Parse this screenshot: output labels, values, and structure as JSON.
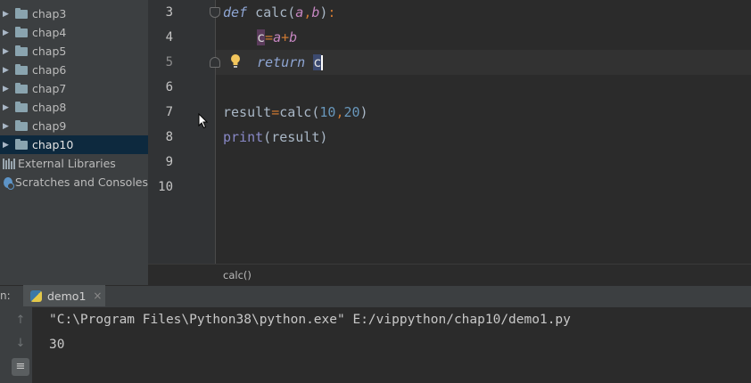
{
  "project_tree": {
    "items": [
      {
        "label": "chap3",
        "icon": "folder-icon",
        "collapsed": true
      },
      {
        "label": "chap4",
        "icon": "folder-icon",
        "collapsed": true
      },
      {
        "label": "chap5",
        "icon": "folder-icon",
        "collapsed": true
      },
      {
        "label": "chap6",
        "icon": "folder-icon",
        "collapsed": true
      },
      {
        "label": "chap7",
        "icon": "folder-icon",
        "collapsed": true
      },
      {
        "label": "chap8",
        "icon": "folder-icon",
        "collapsed": true
      },
      {
        "label": "chap9",
        "icon": "folder-icon",
        "collapsed": true
      },
      {
        "label": "chap10",
        "icon": "folder-icon",
        "collapsed": true,
        "selected": true
      },
      {
        "label": "External Libraries",
        "icon": "library-icon"
      },
      {
        "label": "Scratches and Consoles",
        "icon": "scratch-icon"
      }
    ]
  },
  "editor": {
    "line_numbers": [
      "3",
      "4",
      "5",
      "6",
      "7",
      "8",
      "9",
      "10"
    ],
    "current_line": "5",
    "lines": {
      "l3": {
        "kw": "def",
        "name": " calc",
        "open": "(",
        "p1": "a",
        "comma": ",",
        "p2": "b",
        "close": ")",
        "colon": ":"
      },
      "l4": {
        "var": "c",
        "eq": "=",
        "a": "a",
        "plus": "+",
        "b": "b"
      },
      "l5": {
        "kw": "return",
        "token": "c"
      },
      "l7": {
        "var": "result",
        "eq": "=",
        "call": "calc",
        "open": "(",
        "arg1": "10",
        "comma": ",",
        "arg2": "20",
        "close": ")"
      },
      "l8": {
        "func": "print",
        "open": "(",
        "arg": "result",
        "close": ")"
      }
    },
    "breadcrumb": "calc()"
  },
  "run_panel": {
    "label": "n:",
    "tab": {
      "label": "demo1",
      "close": "×"
    },
    "console": {
      "command": "\"C:\\Program Files\\Python38\\python.exe\" E:/vippython/chap10/demo1.py",
      "output": "30"
    }
  },
  "colors": {
    "editor_bg": "#2b2b2b",
    "sidebar_bg": "#3c3f41",
    "selection": "#0d293e",
    "keyword": "#cc7832",
    "number": "#6897bb",
    "parameter": "#c586c0"
  }
}
